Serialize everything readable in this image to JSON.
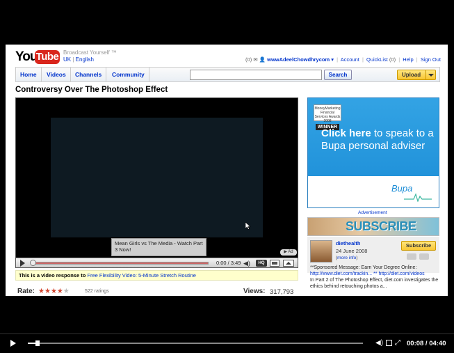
{
  "header": {
    "logo_you": "You",
    "logo_tube": "Tube",
    "tagline": "Broadcast Yourself ™",
    "lang_region": "UK",
    "lang_language": "English",
    "inbox_count": "(0)",
    "username": "wwwAdeelChowdhrycom",
    "account": "Account",
    "quicklist": "QuickList",
    "quicklist_count": "(0)",
    "help": "Help",
    "sign_out": "Sign Out"
  },
  "nav": {
    "tabs": [
      {
        "label": "Home"
      },
      {
        "label": "Videos"
      },
      {
        "label": "Channels"
      },
      {
        "label": "Community"
      }
    ],
    "search_value": "",
    "search_label": "Search",
    "upload_label": "Upload"
  },
  "video": {
    "title": "Controversy Over The Photoshop Effect",
    "annotation": "Mean Girls vs The Media - Watch Part 3 Now!",
    "ad_badge": "▶ Ad",
    "time": "0:00 / 3:49",
    "hq_label": "HQ",
    "progress": 0
  },
  "response": {
    "prefix": "This is a video response to",
    "link": "Free Flexibility Video: 5-Minute Stretch Routine"
  },
  "rating": {
    "label": "Rate:",
    "stars_filled": 4,
    "stars_total": 5,
    "count": "522 ratings",
    "views_label": "Views:",
    "views": "317,793"
  },
  "ad": {
    "award_top": "MoneyMarketing Financial Services Awards 2008",
    "award_winner": "WINNER",
    "headline_bold": "Click here",
    "headline_rest": " to speak to a Bupa personal adviser",
    "brand": "Bupa",
    "label": "Advertisement"
  },
  "channel": {
    "banner": "SUBSCRIBE",
    "name": "diethealth",
    "date": "24 June 2008",
    "more": "(more info)",
    "subscribe_label": "Subscribe",
    "description_1": "**Sponsored Message: Earn Your Degree Online:",
    "link_1": "http://www.diet.com/trackin...",
    "link_2": "** http://diet.com/videos",
    "description_2": "In Part 2 of The Photoshop Effect, diet.com investigates the ethics behind retouching photos a..."
  },
  "bottom_bar": {
    "time": "00:08 / 04:40",
    "progress": 0.029
  }
}
